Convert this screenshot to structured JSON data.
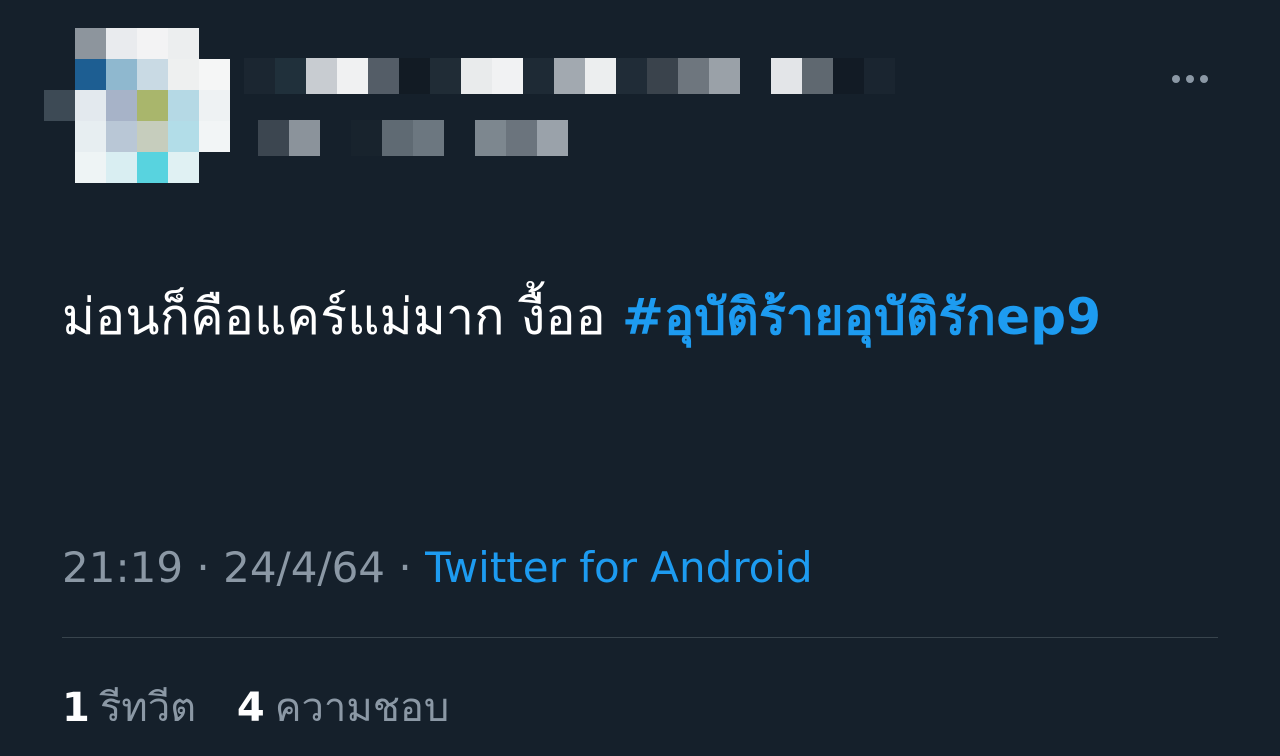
{
  "tweet": {
    "text": "ม่อนก็คือแคร์แม่มาก งื้ออ ",
    "hashtag": "#อุบัติร้ายอุบัติรักep9",
    "time": "21:19",
    "date": "24/4/64",
    "separator": " · ",
    "source": "Twitter for Android"
  },
  "stats": {
    "retweets": {
      "count": "1",
      "label": "รีทวีต"
    },
    "likes": {
      "count": "4",
      "label": "ความชอบ"
    }
  },
  "icons": {
    "more": "more-options-icon"
  },
  "colors": {
    "background": "#15202b",
    "accent": "#1d9bf0",
    "secondary_text": "#8b98a5",
    "divider": "#38444d"
  }
}
